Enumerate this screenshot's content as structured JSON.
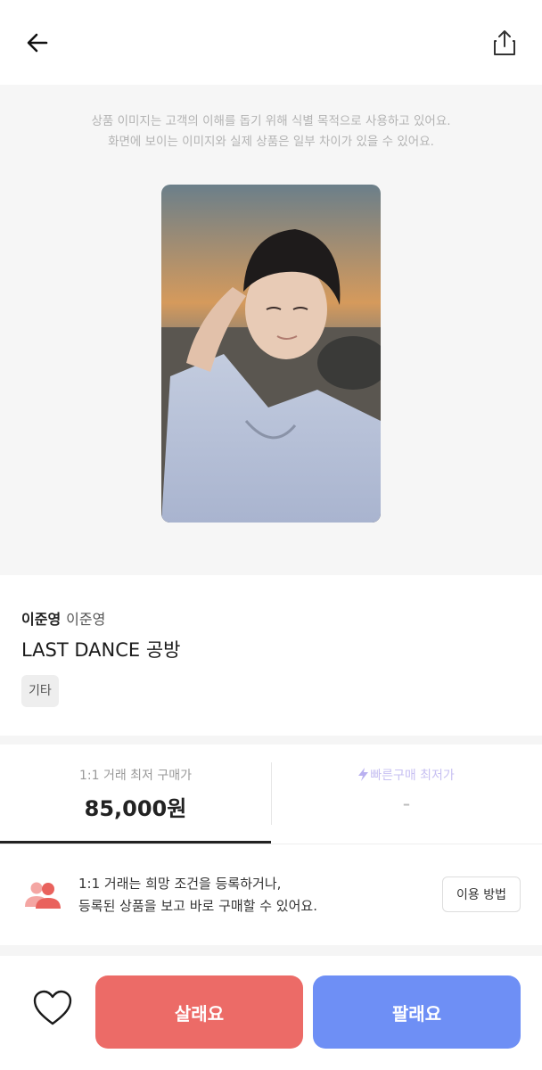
{
  "header": {
    "back_icon": "arrow-left-icon",
    "share_icon": "share-icon"
  },
  "hero": {
    "notice_line1": "상품 이미지는 고객의 이해를 돕기 위해 식별 목적으로 사용하고 있어요.",
    "notice_line2": "화면에 보이는 이미지와 실제 상품은 일부 차이가 있을 수 있어요."
  },
  "product": {
    "artist_bold": "이준영",
    "artist_sub": "이준영",
    "title": "LAST DANCE 공방",
    "tag": "기타"
  },
  "prices": {
    "left_label": "1:1 거래 최저 구매가",
    "left_value": "85,000원",
    "right_label": "빠른구매 최저가",
    "right_value": "-"
  },
  "guide": {
    "line1": "1:1 거래는 희망 조건을 등록하거나,",
    "line2": "등록된 상품을 보고 바로 구매할 수 있어요.",
    "button": "이용 방법",
    "icon": "users-icon"
  },
  "actions": {
    "buy": "살래요",
    "sell": "팔래요",
    "heart_icon": "heart-icon"
  },
  "colors": {
    "buy": "#ec6b67",
    "sell": "#6e8ff5",
    "quick_accent": "#b9b0f0"
  }
}
